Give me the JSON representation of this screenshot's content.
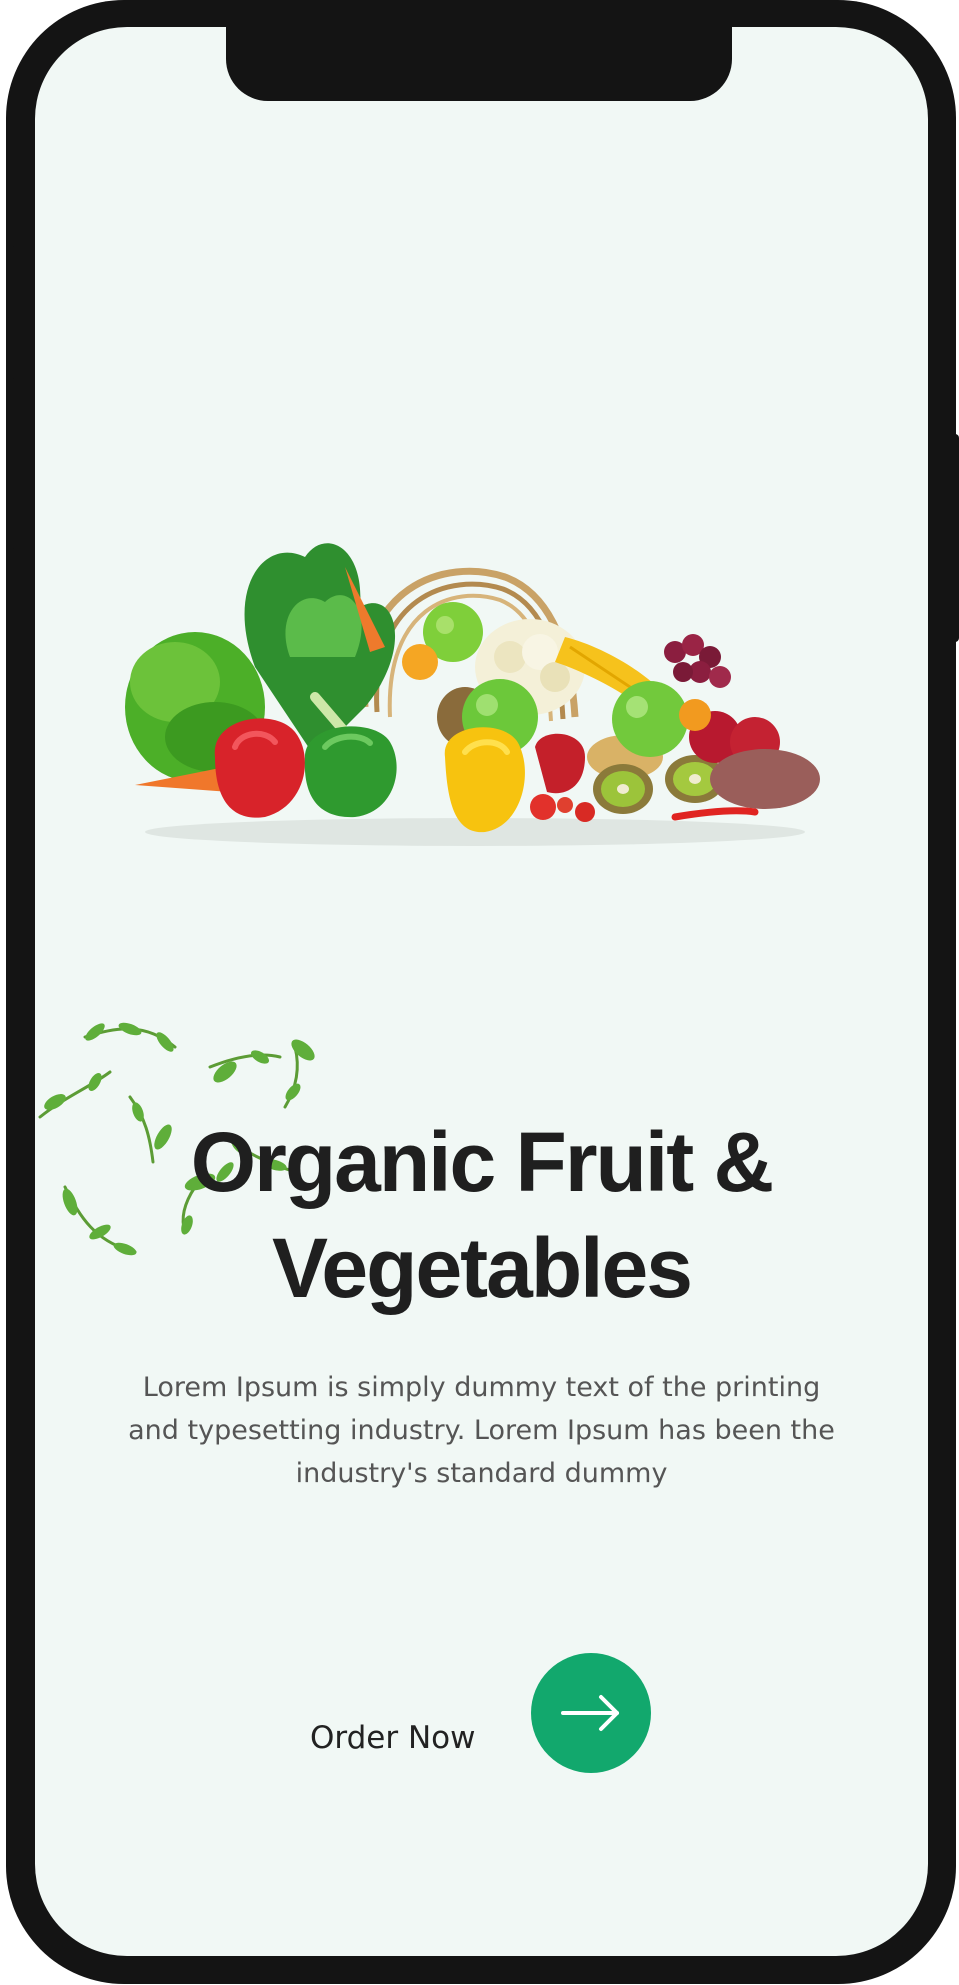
{
  "hero": {
    "image": "fruit-and-vegetable-basket",
    "title_line1": "Organic Fruit &",
    "title_line2": "Vegetables",
    "description": "Lorem Ipsum is simply dummy text of the printing and typesetting industry. Lorem Ipsum has been the industry's standard dummy"
  },
  "cta": {
    "label": "Order Now",
    "icon": "arrow-right-icon"
  },
  "colors": {
    "screen_background": "#f1f8f5",
    "accent": "#12a86d",
    "title": "#1f1f1f",
    "body_text": "#555555",
    "device_frame": "#141414"
  }
}
